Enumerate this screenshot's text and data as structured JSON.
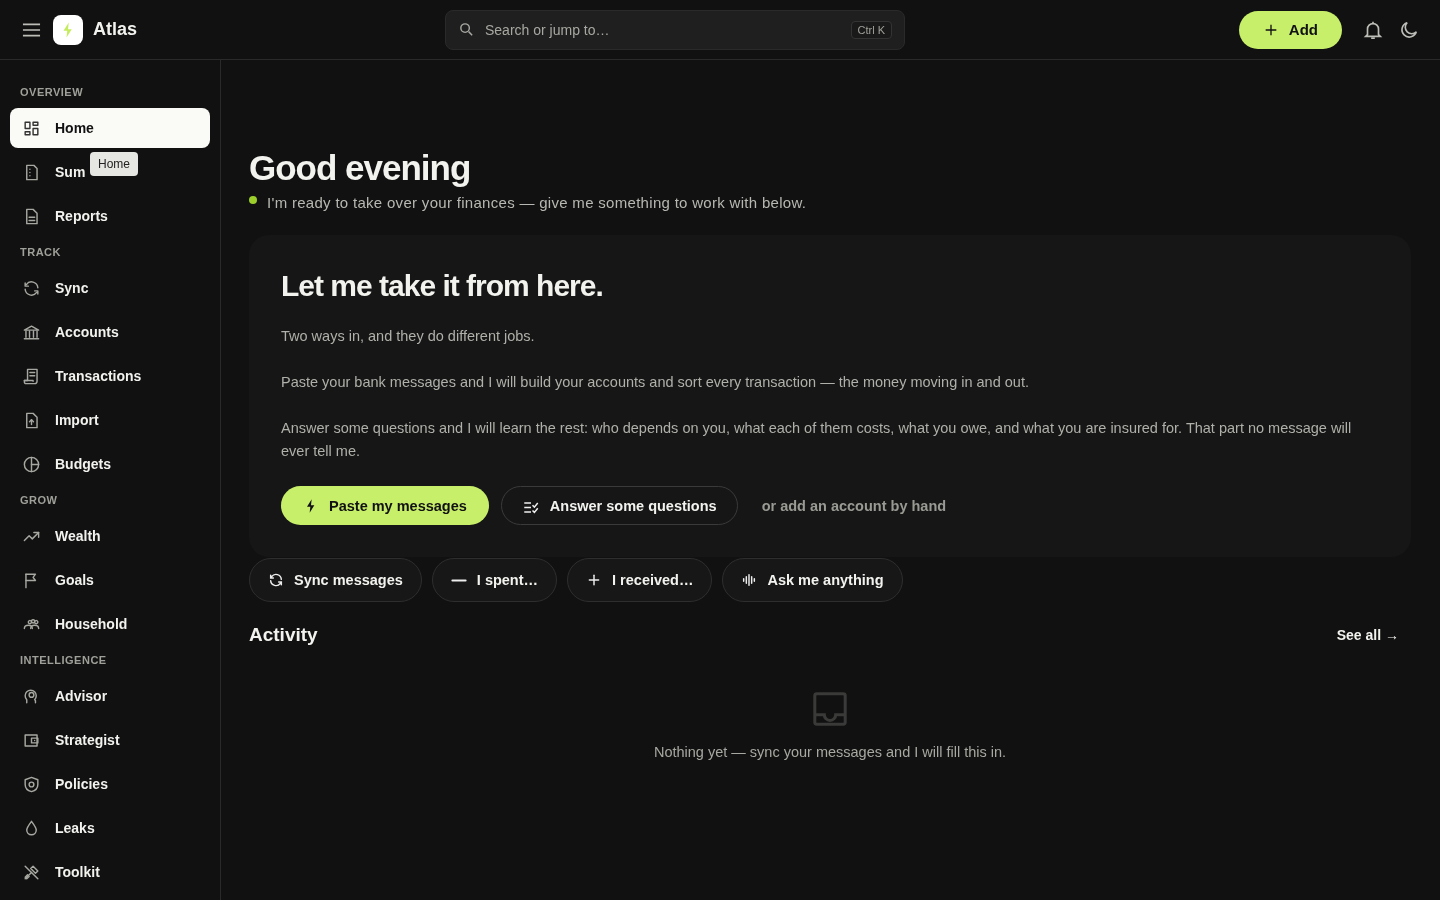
{
  "header": {
    "brand": "Atlas",
    "search": {
      "placeholder": "Search or jump to…",
      "shortcut": "Ctrl K"
    },
    "add_button": "Add"
  },
  "sidebar": {
    "sections": [
      {
        "title": "OVERVIEW",
        "items": [
          {
            "label": "Home",
            "selected": true
          },
          {
            "label": "Sum",
            "selected": false
          },
          {
            "label": "Reports",
            "selected": false
          }
        ]
      },
      {
        "title": "TRACK",
        "items": [
          {
            "label": "Sync",
            "selected": false
          },
          {
            "label": "Accounts",
            "selected": false
          },
          {
            "label": "Transactions",
            "selected": false
          },
          {
            "label": "Import",
            "selected": false
          },
          {
            "label": "Budgets",
            "selected": false
          }
        ]
      },
      {
        "title": "GROW",
        "items": [
          {
            "label": "Wealth",
            "selected": false
          },
          {
            "label": "Goals",
            "selected": false
          },
          {
            "label": "Household",
            "selected": false
          }
        ]
      },
      {
        "title": "INTELLIGENCE",
        "items": [
          {
            "label": "Advisor",
            "selected": false
          },
          {
            "label": "Strategist",
            "selected": false
          },
          {
            "label": "Policies",
            "selected": false
          },
          {
            "label": "Leaks",
            "selected": false
          },
          {
            "label": "Toolkit",
            "selected": false
          }
        ]
      }
    ]
  },
  "tooltip": "Home",
  "greeting": {
    "title": "Good evening",
    "status": "I'm ready to take over your finances — give me something to work with below."
  },
  "hero": {
    "title": "Let me take it from here.",
    "paragraphs": [
      "Two ways in, and they do different jobs.",
      "Paste your bank messages and I will build your accounts and sort every transaction — the money moving in and out.",
      "Answer some questions and I will learn the rest: who depends on you, what each of them costs, what you owe, and what you are insured for. That part no message will ever tell me."
    ],
    "actions": [
      {
        "label": "Paste my messages",
        "kind": "primary"
      },
      {
        "label": "Answer some questions",
        "kind": "outline"
      },
      {
        "label": "or add an account by hand",
        "kind": "link"
      }
    ]
  },
  "quick_actions": [
    {
      "label": "Sync messages"
    },
    {
      "label": "I spent…"
    },
    {
      "label": "I received…"
    },
    {
      "label": "Ask me anything"
    }
  ],
  "activity": {
    "title": "Activity",
    "see_all": "See all →",
    "empty": "Nothing yet — sync your messages and I will fill this in."
  }
}
